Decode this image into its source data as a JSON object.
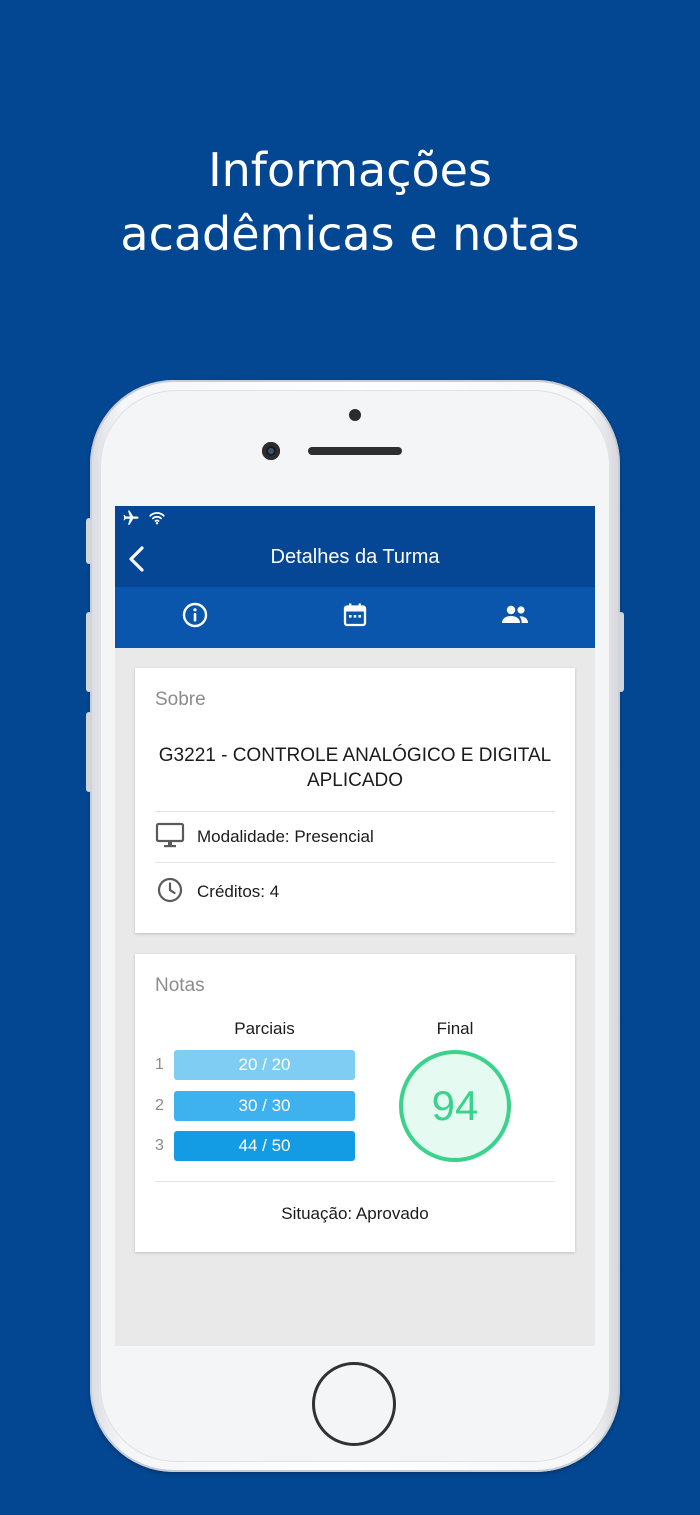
{
  "headline": {
    "line1": "Informações",
    "line2": "acadêmicas e notas"
  },
  "phone": {
    "nav": {
      "title": "Detalhes da Turma",
      "back_icon": "chevron-left-icon"
    },
    "status_icons": [
      "airplane-icon",
      "wifi-icon"
    ],
    "tabs": [
      {
        "icon": "info-icon"
      },
      {
        "icon": "calendar-icon"
      },
      {
        "icon": "people-icon"
      }
    ],
    "about": {
      "title": "Sobre",
      "course_name": "G3221 - CONTROLE ANALÓGICO E DIGITAL APLICADO",
      "modalidade": "Modalidade: Presencial",
      "creditos": "Créditos: 4"
    },
    "grades": {
      "title": "Notas",
      "partials_label": "Parciais",
      "final_label": "Final",
      "partials": [
        {
          "index": "1",
          "text": "20 / 20",
          "color": "#7fcdf3"
        },
        {
          "index": "2",
          "text": "30 / 30",
          "color": "#3eb2ef"
        },
        {
          "index": "3",
          "text": "44 / 50",
          "color": "#139be3"
        }
      ],
      "final": "94",
      "final_color": "#3bd28e",
      "situacao": "Situação: Aprovado"
    }
  },
  "colors": {
    "background": "#034793",
    "header": "#054794",
    "tabbar": "#0b56ad"
  }
}
